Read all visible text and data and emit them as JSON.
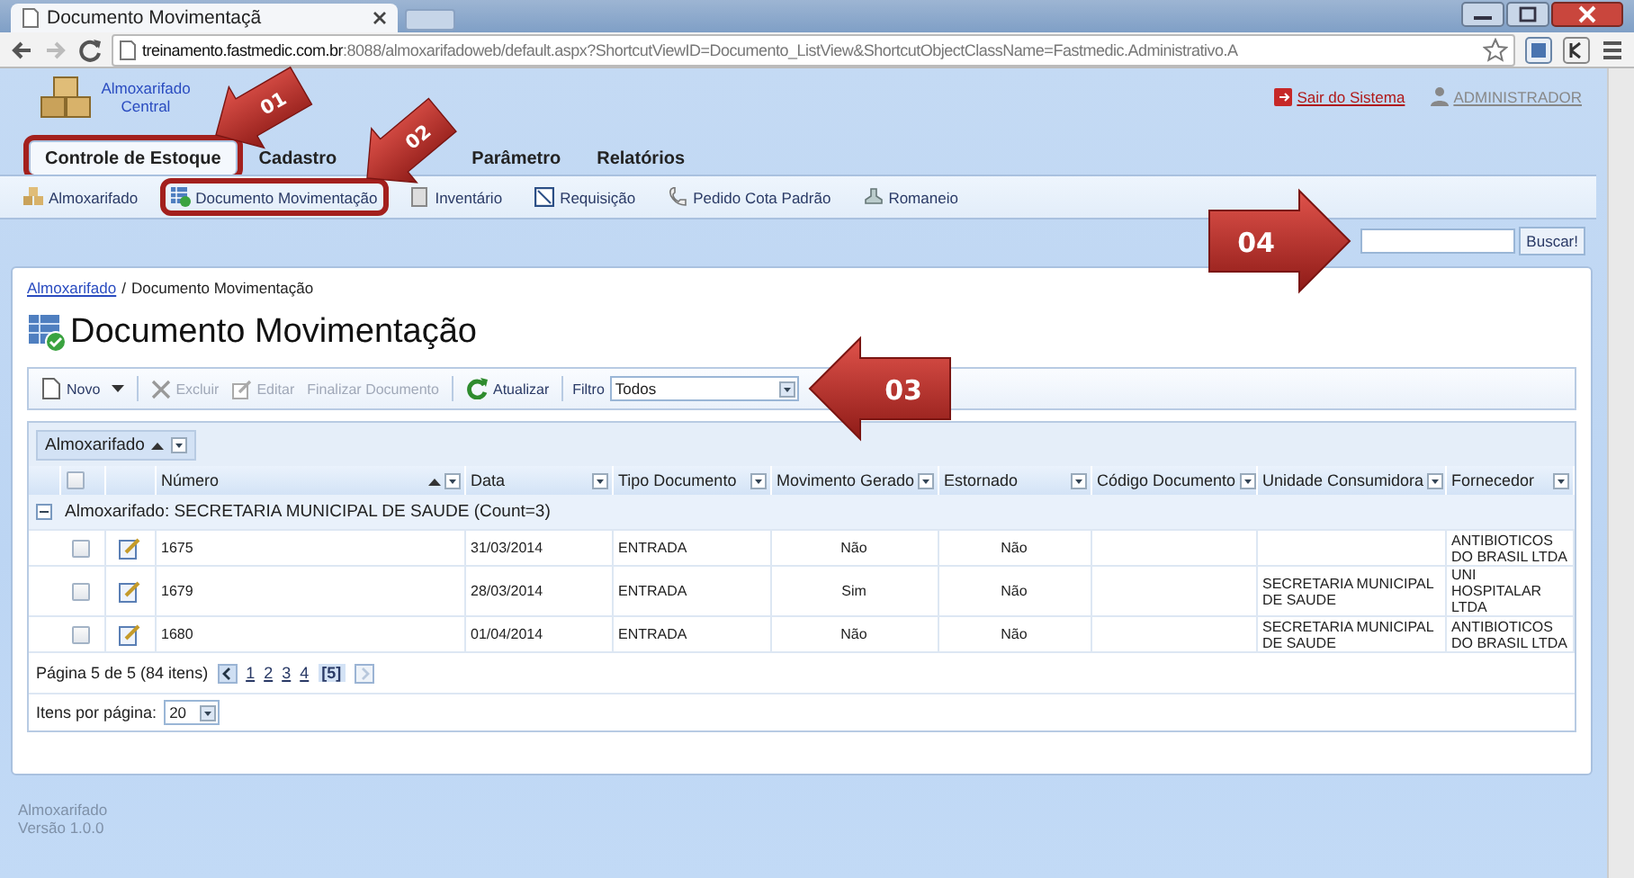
{
  "browser": {
    "tab_title": "Documento Movimentaçã",
    "url_host": "treinamento.fastmedic.com.br",
    "url_rest": ":8088/almoxarifadoweb/default.aspx?ShortcutViewID=Documento_ListView&ShortcutObjectClassName=Fastmedic.Administrativo.A"
  },
  "app_name": "Almoxarifado Central",
  "header_links": [
    {
      "label": "Sair do Sistema",
      "kind": "logout"
    },
    {
      "label": "ADMINISTRADOR",
      "kind": "user"
    }
  ],
  "menu_tabs": [
    {
      "label": "Controle de Estoque",
      "selected": true,
      "highlighted": true
    },
    {
      "label": "Cadastro",
      "selected": false,
      "highlighted": false
    },
    {
      "label": "Parâmetro",
      "selected": false,
      "highlighted": false
    },
    {
      "label": "Relatórios",
      "selected": false,
      "highlighted": false
    }
  ],
  "submenu": [
    {
      "label": "Almoxarifado",
      "highlighted": false
    },
    {
      "label": "Documento Movimentação",
      "highlighted": true
    },
    {
      "label": "Inventário",
      "highlighted": false
    },
    {
      "label": "Requisição",
      "highlighted": false
    },
    {
      "label": "Pedido Cota Padrão",
      "highlighted": false
    },
    {
      "label": "Romaneio",
      "highlighted": false
    }
  ],
  "search": {
    "button": "Buscar!"
  },
  "breadcrumb": [
    {
      "label": "Almoxarifado",
      "kind": "link"
    },
    {
      "label": "/",
      "kind": "separator"
    },
    {
      "label": "Documento Movimentação",
      "kind": "current"
    }
  ],
  "title": "Documento Movimentação",
  "toolbar": [
    {
      "label": "Novo",
      "kind": "new",
      "disabled": false,
      "dropdown": true
    },
    {
      "kind": "separator"
    },
    {
      "label": "Excluir",
      "kind": "delete",
      "disabled": true,
      "dropdown": false
    },
    {
      "label": "Editar",
      "kind": "edit",
      "disabled": true,
      "dropdown": false
    },
    {
      "label": "Finalizar Documento",
      "kind": "finalize",
      "disabled": true,
      "dropdown": false
    },
    {
      "kind": "separator"
    },
    {
      "label": "Atualizar",
      "kind": "refresh",
      "disabled": false,
      "dropdown": false
    },
    {
      "kind": "separator"
    }
  ],
  "filter": {
    "label": "Filtro",
    "value": "Todos"
  },
  "grid": {
    "group_by": "Almoxarifado",
    "header_checked": false,
    "columns": [
      {
        "label": "Número",
        "sorted": true
      },
      {
        "label": "Data",
        "sorted": false
      },
      {
        "label": "Tipo Documento",
        "sorted": false
      },
      {
        "label": "Movimento Gerado",
        "sorted": false
      },
      {
        "label": "Estornado",
        "sorted": false
      },
      {
        "label": "Código Documento",
        "sorted": false
      },
      {
        "label": "Unidade Consumidora",
        "sorted": false
      },
      {
        "label": "Fornecedor",
        "sorted": false
      }
    ],
    "group_row": {
      "label": "Almoxarifado: SECRETARIA MUNICIPAL DE SAUDE (Count=3)",
      "expanded": true
    },
    "rows": [
      {
        "checked": false,
        "numero": "1675",
        "data": "31/03/2014",
        "tipo": "ENTRADA",
        "movimento": "Não",
        "estornado": "Não",
        "fornecedor": "ANTIBIOTICOS DO BRASIL LTDA"
      },
      {
        "checked": false,
        "numero": "1679",
        "data": "28/03/2014",
        "tipo": "ENTRADA",
        "movimento": "Sim",
        "estornado": "Não",
        "unidade": "SECRETARIA MUNICIPAL DE SAUDE",
        "fornecedor": "UNI HOSPITALAR LTDA"
      },
      {
        "checked": false,
        "numero": "1680",
        "data": "01/04/2014",
        "tipo": "ENTRADA",
        "movimento": "Não",
        "estornado": "Não",
        "unidade": "SECRETARIA MUNICIPAL DE SAUDE",
        "fornecedor": "ANTIBIOTICOS DO BRASIL LTDA"
      }
    ]
  },
  "pager": {
    "summary": "Página 5 de 5 (84 itens)",
    "prev_disabled": false,
    "next_disabled": true,
    "pages": [
      {
        "label": "1",
        "selected": false
      },
      {
        "label": "2",
        "selected": false
      },
      {
        "label": "3",
        "selected": false
      },
      {
        "label": "4",
        "selected": false
      },
      {
        "label": "[5]",
        "selected": true
      }
    ]
  },
  "page_size": {
    "label": "Itens por página:",
    "value": "20"
  },
  "footer": [
    "Almoxarifado",
    "Versão 1.0.0"
  ],
  "annotations": [
    {
      "label": "01"
    },
    {
      "label": "02"
    },
    {
      "label": "03"
    },
    {
      "label": "04"
    }
  ]
}
